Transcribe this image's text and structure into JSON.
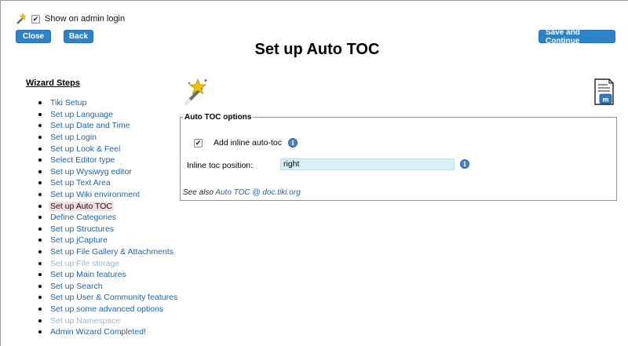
{
  "header": {
    "show_on_login_label": "Show on admin login",
    "show_on_login_checked": true,
    "close_label": "Close",
    "back_label": "Back",
    "save_continue_label": "Save and Continue",
    "page_title": "Set up Auto TOC"
  },
  "sidebar": {
    "heading": "Wizard Steps",
    "items": [
      {
        "label": "Tiki Setup"
      },
      {
        "label": "Set up Language"
      },
      {
        "label": "Set up Date and Time"
      },
      {
        "label": "Set up Login"
      },
      {
        "label": "Set up Look & Feel"
      },
      {
        "label": "Select Editor type"
      },
      {
        "label": "Set up Wysiwyg editor"
      },
      {
        "label": "Set up Text Area"
      },
      {
        "label": "Set up Wiki environment"
      },
      {
        "label": "Set up Auto TOC"
      },
      {
        "label": "Define Categories"
      },
      {
        "label": "Set up Structures"
      },
      {
        "label": "Set up jCapture"
      },
      {
        "label": "Set up File Gallery & Attachments"
      },
      {
        "label": "Set up File storage"
      },
      {
        "label": "Set up Main features"
      },
      {
        "label": "Set up Search"
      },
      {
        "label": "Set up User & Community features"
      },
      {
        "label": "Set up some advanced options"
      },
      {
        "label": "Set up Namespace"
      },
      {
        "label": "Admin Wizard Completed!"
      }
    ]
  },
  "main": {
    "fieldset_legend": "Auto TOC options",
    "inline_toc_label": "Add inline auto-toc",
    "inline_toc_checked": true,
    "position_label": "Inline toc position:",
    "position_value": "right",
    "see_also_prefix": "See also ",
    "see_also_link": "Auto TOC @ doc.tiki.org"
  },
  "colors": {
    "button": "#2e82c8",
    "link": "#1f63a7",
    "active_step_bg": "#f5dde0",
    "input_bg": "#d8f0f6"
  }
}
